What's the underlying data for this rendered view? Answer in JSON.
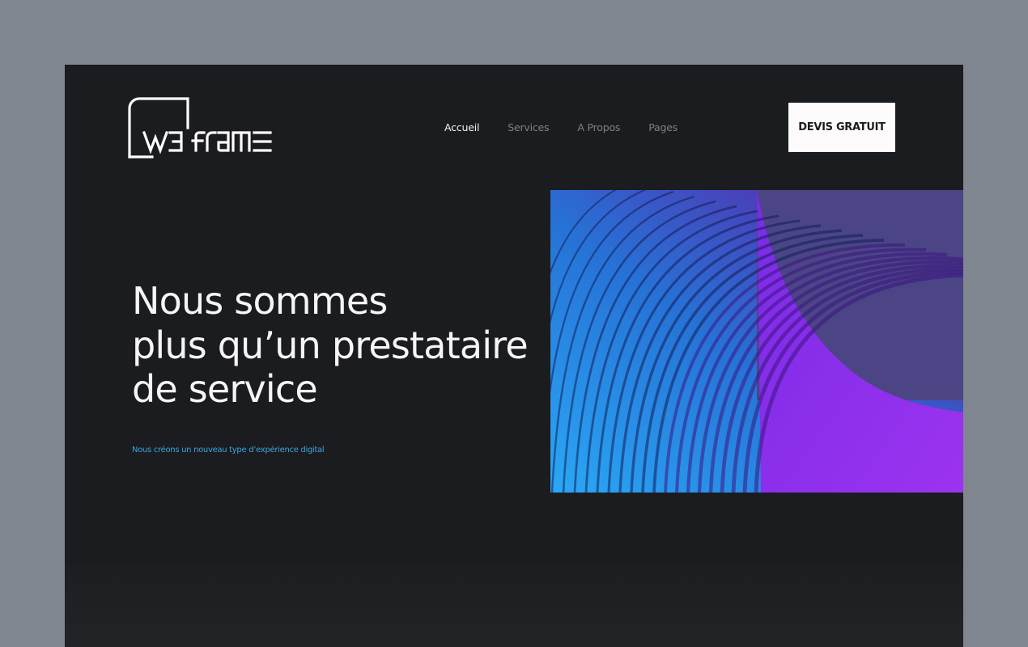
{
  "brand": {
    "logo_text": "W3frame"
  },
  "nav": {
    "items": [
      {
        "label": "Accueil",
        "active": true
      },
      {
        "label": "Services",
        "active": false
      },
      {
        "label": "A Propos",
        "active": false
      },
      {
        "label": "Pages",
        "active": false
      }
    ]
  },
  "cta": {
    "label": "DEVIS GRATUIT"
  },
  "hero": {
    "title_lines": [
      "Nous sommes",
      "plus qu’un prestataire",
      "de service"
    ],
    "subtitle": "Nous créons un nouveau type d’expérience digital"
  },
  "colors": {
    "page_bg": "#1b1c1f",
    "outer_bg": "#7f868f",
    "subtitle": "#3aa6de",
    "nav_active": "#f2f2f2",
    "nav_inactive": "#7e8084",
    "cta_bg": "#fdfbfb",
    "image_purple": "#8a2be2",
    "image_blue": "#2fa4f0"
  }
}
